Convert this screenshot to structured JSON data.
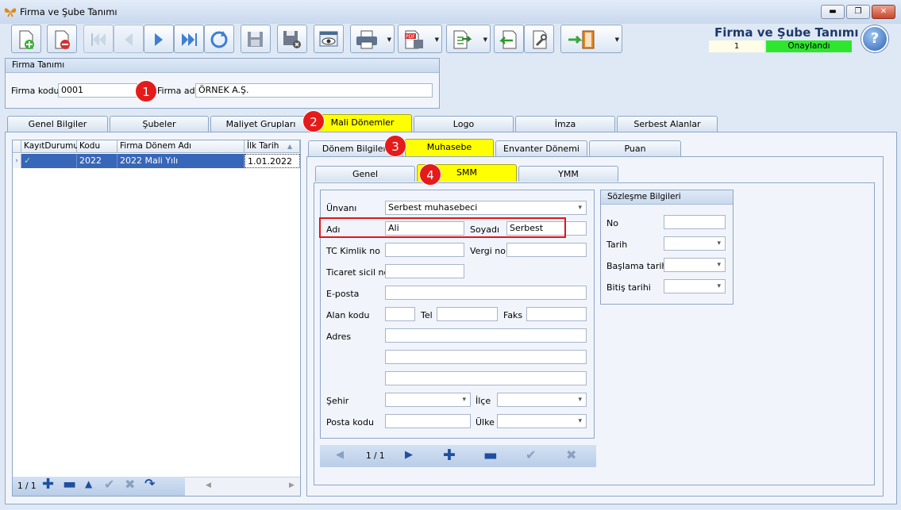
{
  "window": {
    "title": "Firma ve Şube Tanımı",
    "controls": [
      "minimize",
      "restore",
      "close"
    ]
  },
  "toolbar": {
    "buttons": [
      {
        "name": "new-record-button",
        "icon": "new-document-icon"
      },
      {
        "name": "delete-record-button",
        "icon": "delete-document-icon"
      },
      {
        "name": "first-record-button",
        "icon": "first-icon"
      },
      {
        "name": "previous-record-button",
        "icon": "previous-icon"
      },
      {
        "name": "next-record-button",
        "icon": "next-icon"
      },
      {
        "name": "last-record-button",
        "icon": "last-icon"
      },
      {
        "name": "refresh-button",
        "icon": "refresh-icon"
      },
      {
        "name": "save-button",
        "icon": "save-icon"
      },
      {
        "name": "save-cancel-button",
        "icon": "save-cancel-icon"
      },
      {
        "name": "preview-button",
        "icon": "preview-icon"
      },
      {
        "name": "print-button",
        "icon": "printer-icon"
      },
      {
        "name": "export-pdf-button",
        "icon": "pdf-icon"
      },
      {
        "name": "export-button",
        "icon": "export-icon"
      },
      {
        "name": "import-button",
        "icon": "import-icon"
      },
      {
        "name": "settings-button",
        "icon": "tools-icon"
      },
      {
        "name": "exit-button",
        "icon": "exit-door-icon"
      }
    ]
  },
  "header": {
    "title": "Firma ve Şube Tanımı",
    "record_no": "1",
    "status": "Onaylandı"
  },
  "firma_tanimi": {
    "group_title": "Firma Tanımı",
    "firma_kodu_label": "Firma kodu",
    "firma_kodu_value": "0001",
    "firma_adi_label": "Firma adı",
    "firma_adi_value": "ÖRNEK A.Ş."
  },
  "main_tabs": [
    "Genel Bilgiler",
    "Şubeler",
    "Maliyet Grupları",
    "Mali Dönemler",
    "Logo",
    "İmza",
    "Serbest Alanlar"
  ],
  "grid": {
    "columns": [
      "KayıtDurumu",
      "Kodu",
      "Firma Dönem Adı",
      "İlk Tarih"
    ],
    "rows": [
      {
        "status": "Onaylandı",
        "code": "2022",
        "name": "2022 Mali Yılı",
        "date": "1.01.2022"
      }
    ],
    "page": "1 / 1"
  },
  "sub_tabs": [
    "Dönem Bilgileri",
    "Muhasebe",
    "Envanter Dönemi",
    "Puan"
  ],
  "inner_tabs": [
    "Genel",
    "SMM",
    "YMM"
  ],
  "smm_form": {
    "unvan_label": "Ünvanı",
    "unvan_value": "Serbest muhasebeci",
    "adi_label": "Adı",
    "adi_value": "Ali",
    "soyadi_label": "Soyadı",
    "soyadi_value": "Serbest",
    "tc_label": "TC Kimlik no",
    "vergi_label": "Vergi no",
    "ticaret_label": "Ticaret sicil no",
    "eposta_label": "E-posta",
    "alan_kodu_label": "Alan kodu",
    "tel_label": "Tel",
    "faks_label": "Faks",
    "adres_label": "Adres",
    "sehir_label": "Şehir",
    "ilce_label": "İlçe",
    "posta_label": "Posta kodu",
    "ulke_label": "Ülke",
    "page": "1 / 1"
  },
  "sozlesme": {
    "title": "Sözleşme Bilgileri",
    "no_label": "No",
    "tarih_label": "Tarih",
    "baslama_label": "Başlama tarihi",
    "bitis_label": "Bitiş tarihi"
  },
  "badges": [
    "1",
    "2",
    "3",
    "4"
  ],
  "colors": {
    "highlight": "#ffff00",
    "badge": "#e51b1b",
    "approved": "#2ee62e",
    "selection": "#3866b8"
  }
}
